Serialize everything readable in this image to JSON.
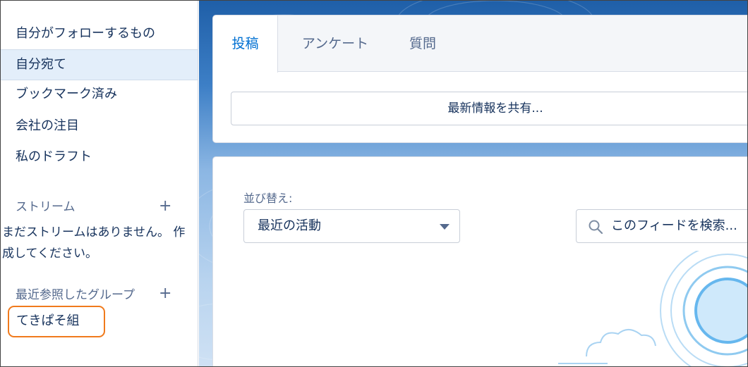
{
  "sidebar": {
    "items": [
      {
        "label": "自分がフォローするもの"
      },
      {
        "label": "自分宛て"
      },
      {
        "label": "ブックマーク済み"
      },
      {
        "label": "会社の注目"
      },
      {
        "label": "私のドラフト"
      }
    ],
    "streams": {
      "title": "ストリーム",
      "add": "+",
      "empty_message": "まだストリームはありません。 作成してください。"
    },
    "recent_groups": {
      "title": "最近参照したグループ",
      "add": "+",
      "items": [
        {
          "label": "てきぱそ組"
        }
      ]
    }
  },
  "publisher": {
    "tabs": [
      {
        "label": "投稿"
      },
      {
        "label": "アンケート"
      },
      {
        "label": "質問"
      }
    ],
    "share_label": "最新情報を共有..."
  },
  "feed": {
    "sort_label": "並び替え:",
    "sort_value": "最近の活動",
    "search_placeholder": "このフィードを検索..."
  },
  "colors": {
    "accent": "#0070d2",
    "highlight_border": "#f07a1c",
    "active_nav_bg": "#e3eefa"
  }
}
